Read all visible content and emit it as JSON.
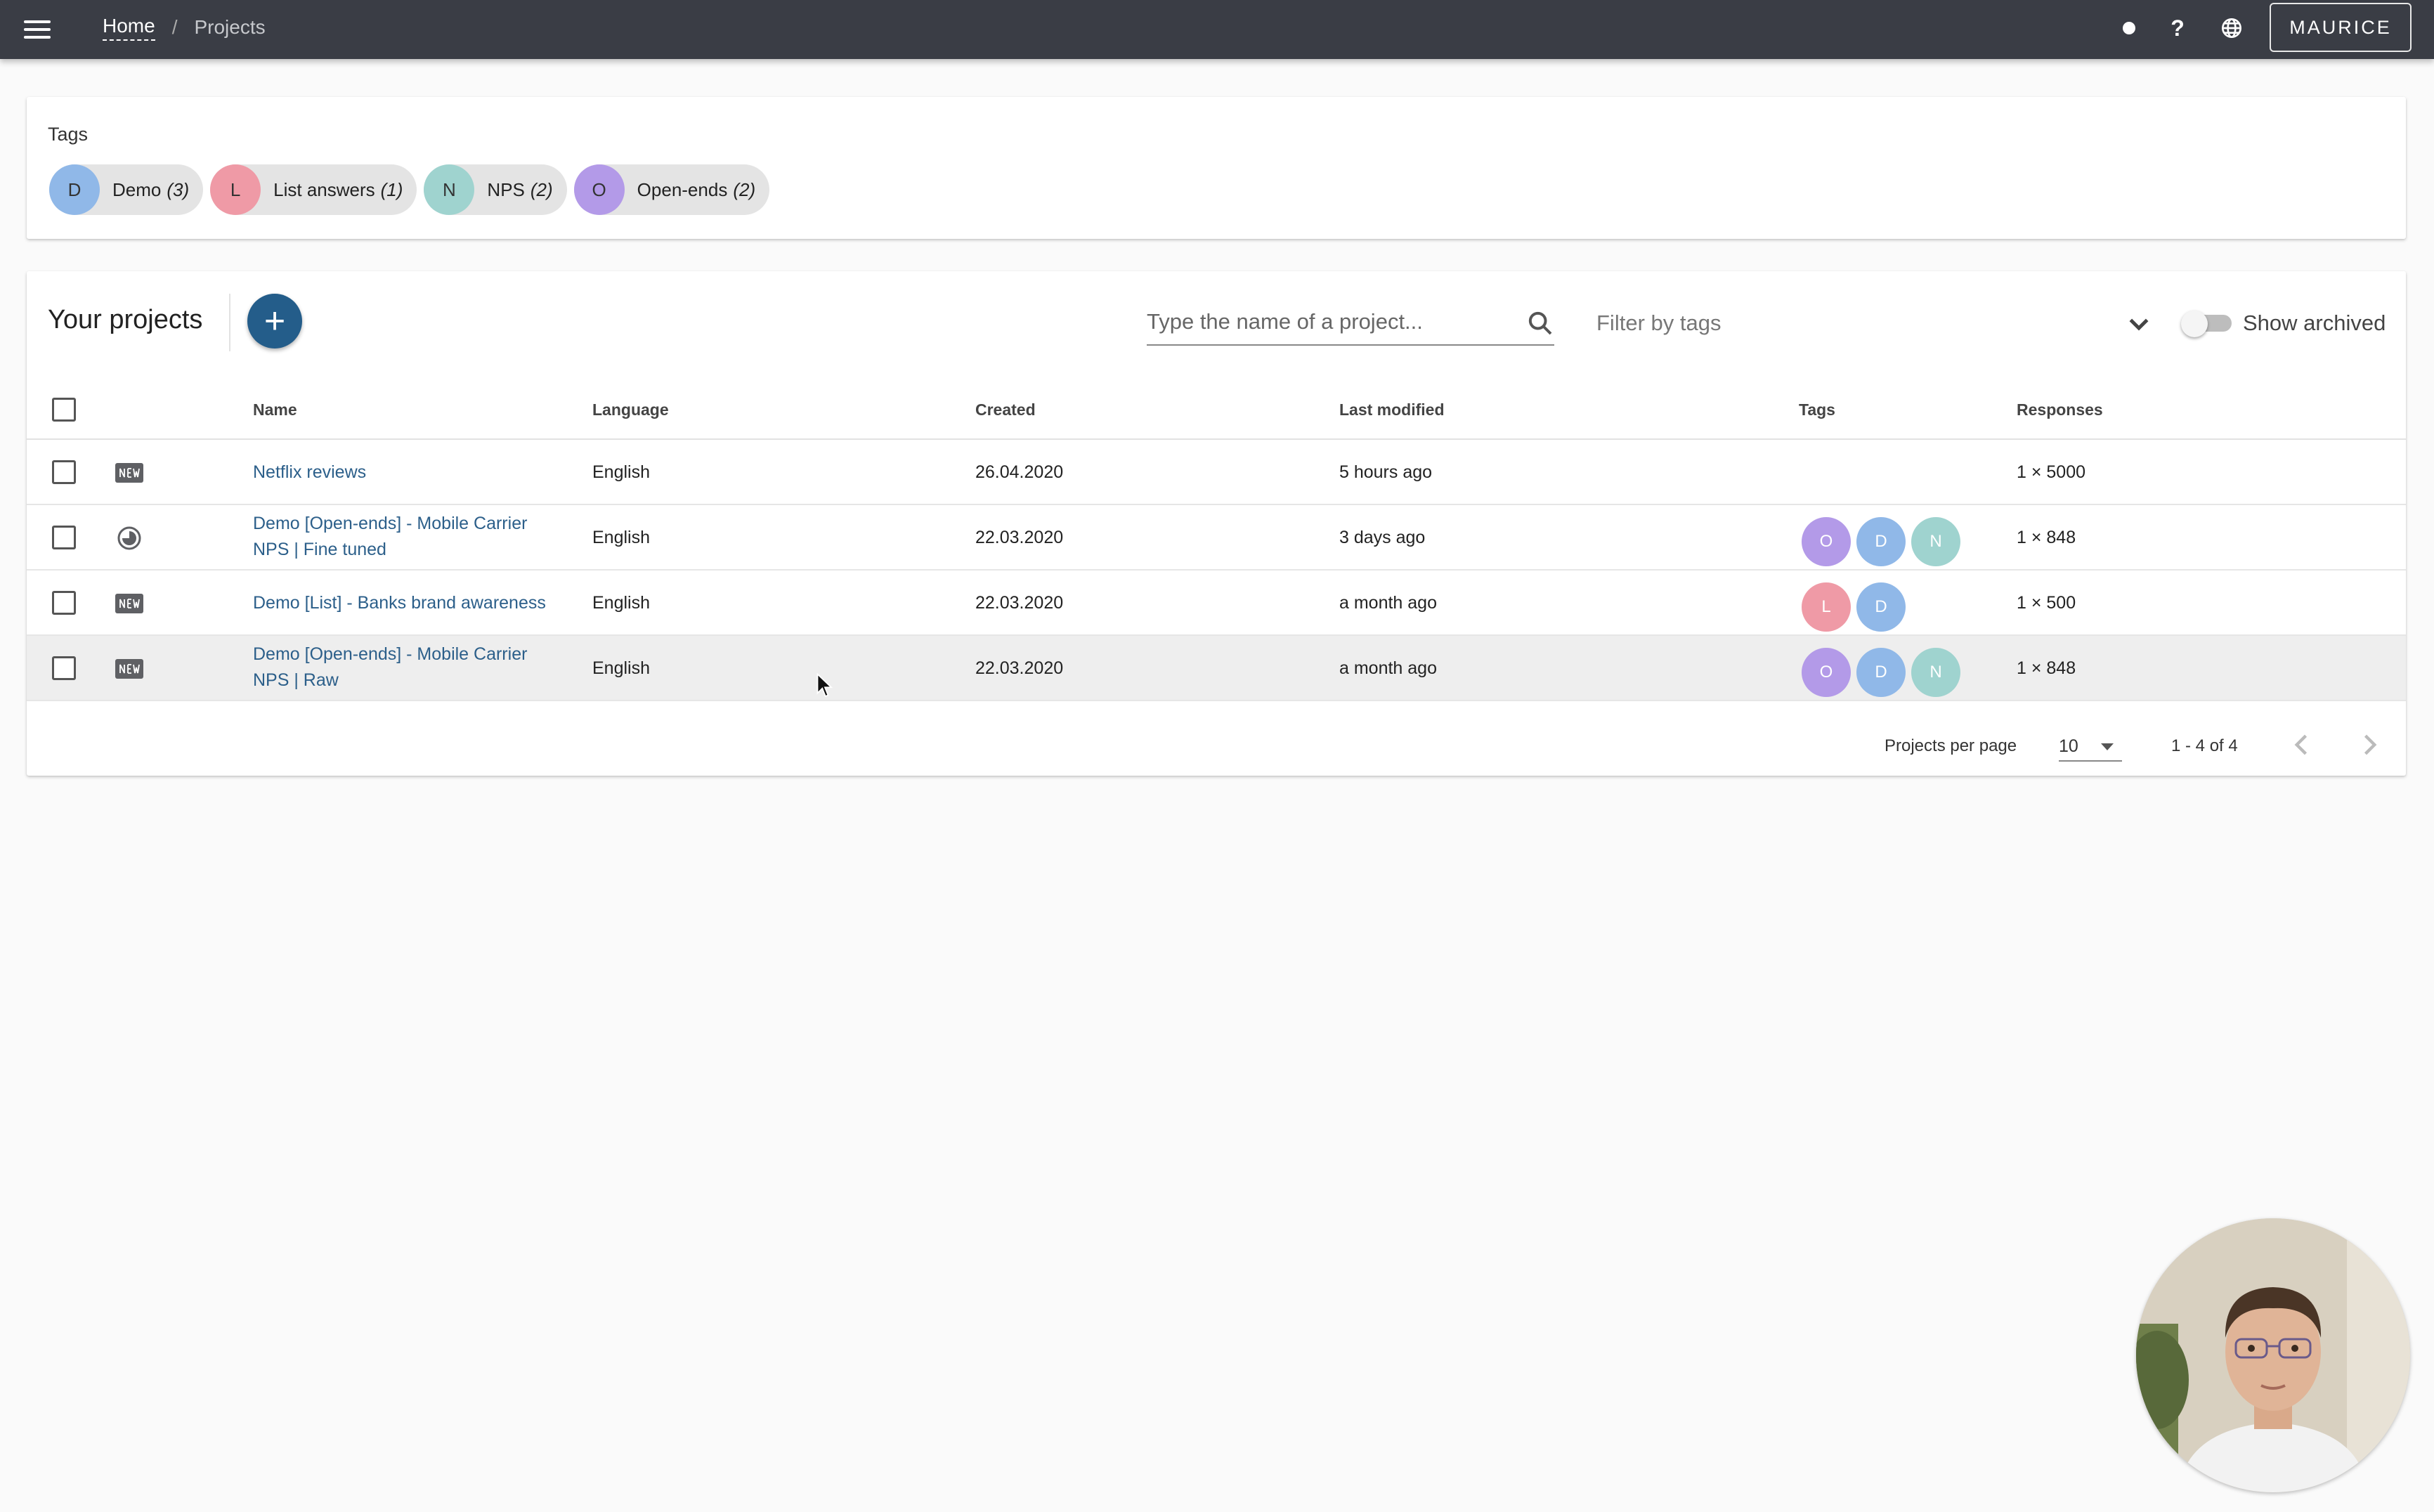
{
  "header": {
    "breadcrumb": {
      "home": "Home",
      "separator": "/",
      "current": "Projects"
    },
    "user_button": "MAURICE",
    "icons": [
      "menu-icon",
      "status-dot-icon",
      "help-icon",
      "globe-icon"
    ],
    "help_glyph": "?"
  },
  "tags": {
    "title": "Tags",
    "chips": [
      {
        "initial": "D",
        "label": "Demo",
        "count": "(3)",
        "color": "#90b8e8"
      },
      {
        "initial": "L",
        "label": "List answers",
        "count": "(1)",
        "color": "#ef9aa6"
      },
      {
        "initial": "N",
        "label": "NPS",
        "count": "(2)",
        "color": "#9fd3cf"
      },
      {
        "initial": "O",
        "label": "Open-ends",
        "count": "(2)",
        "color": "#b39ae8"
      }
    ]
  },
  "projects": {
    "title": "Your projects",
    "add_glyph": "+",
    "search_placeholder": "Type the name of a project...",
    "filter_placeholder": "Filter by tags",
    "show_archived_label": "Show archived",
    "columns": {
      "name": "Name",
      "language": "Language",
      "created": "Created",
      "last_modified": "Last modified",
      "tags": "Tags",
      "responses": "Responses"
    },
    "rows": [
      {
        "name": "Netflix reviews",
        "type_icon": "new-badge-icon",
        "language": "English",
        "created": "26.04.2020",
        "last_modified": "5 hours ago",
        "tags": [],
        "responses": "1 × 5000"
      },
      {
        "name": "Demo [Open-ends] - Mobile Carrier NPS | Fine tuned",
        "type_icon": "progress-circle-icon",
        "language": "English",
        "created": "22.03.2020",
        "last_modified": "3 days ago",
        "tags": [
          "O",
          "D",
          "N"
        ],
        "responses": "1 × 848"
      },
      {
        "name": "Demo [List] - Banks brand awareness",
        "type_icon": "new-badge-icon",
        "language": "English",
        "created": "22.03.2020",
        "last_modified": "a month ago",
        "tags": [
          "L",
          "D"
        ],
        "responses": "1 × 500"
      },
      {
        "name": "Demo [Open-ends] - Mobile Carrier NPS | Raw",
        "type_icon": "new-badge-icon",
        "language": "English",
        "created": "22.03.2020",
        "last_modified": "a month ago",
        "tags": [
          "O",
          "D",
          "N"
        ],
        "responses": "1 × 848"
      }
    ],
    "tag_colors": {
      "O": "#b39ae8",
      "D": "#90b8e8",
      "N": "#9fd3cf",
      "L": "#ef9aa6"
    },
    "pagination": {
      "per_page_label": "Projects per page",
      "per_page_value": "10",
      "range": "1 - 4 of 4"
    }
  },
  "colors": {
    "topbar": "#3a3d45",
    "accent": "#245d8a",
    "link": "#2c5f8a"
  }
}
